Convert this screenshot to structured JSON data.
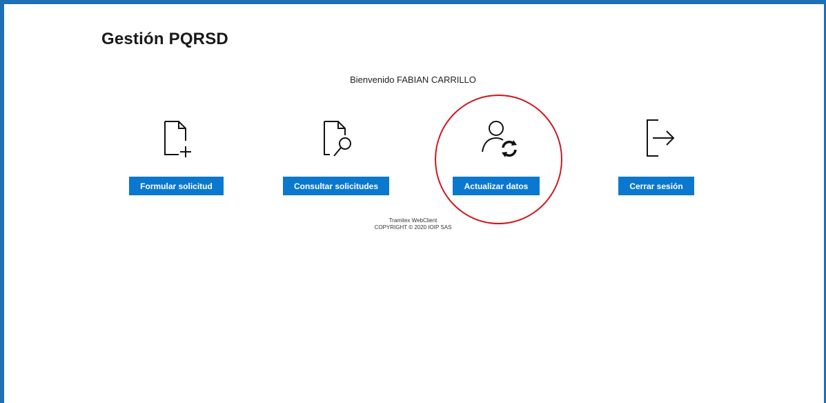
{
  "header": {
    "title": "Gestión PQRSD"
  },
  "welcome": {
    "text": "Bienvenido FABIAN CARRILLO"
  },
  "actions": [
    {
      "label": "Formular solicitud",
      "icon": "new-document-icon"
    },
    {
      "label": "Consultar solicitudes",
      "icon": "document-search-icon"
    },
    {
      "label": "Actualizar datos",
      "icon": "user-refresh-icon"
    },
    {
      "label": "Cerrar sesión",
      "icon": "sign-out-icon"
    }
  ],
  "footer": {
    "line1": "Tramitex WebClient",
    "line2": "COPYRIGHT © 2020 IOIP SAS"
  },
  "colors": {
    "frame": "#1f6fb5",
    "button": "#0b78d0",
    "highlight": "#d0161e"
  },
  "annotation": {
    "highlighted_action": "Actualizar datos"
  }
}
